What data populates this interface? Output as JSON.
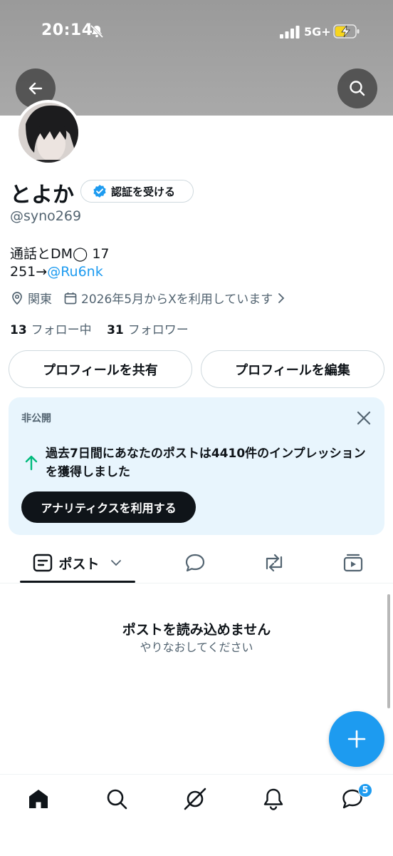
{
  "status_bar": {
    "time": "20:14",
    "network": "5G+"
  },
  "profile": {
    "name": "とよか",
    "verify_label": "認証を受ける",
    "handle": "@syno269",
    "bio_line1": "通話とDM◯ 17",
    "bio_line2_prefix": "251→",
    "bio_link": "@Ru6nk",
    "location": "関東",
    "joined": "2026年5月からXを利用しています",
    "following_count": "13",
    "following_label": "フォロー中",
    "followers_count": "31",
    "followers_label": "フォロワー"
  },
  "actions": {
    "share_label": "プロフィールを共有",
    "edit_label": "プロフィールを編集"
  },
  "analytics_card": {
    "label": "非公開",
    "message": "過去7日間にあなたのポストは4410件のインプレッションを獲得しました",
    "button_label": "アナリティクスを利用する"
  },
  "tabs": {
    "posts_label": "ポスト"
  },
  "empty_state": {
    "title": "ポストを読み込めません",
    "subtitle": "やりなおしてください"
  },
  "bottom_nav": {
    "messages_badge": "5"
  },
  "colors": {
    "accent": "#1d9bf0",
    "text": "#0f1419",
    "secondary": "#536471",
    "card_bg": "#e8f5fd",
    "trend_up": "#00ba7c"
  },
  "icons": [
    "back-arrow-icon",
    "search-icon",
    "verified-badge-icon",
    "location-pin-icon",
    "calendar-icon",
    "chevron-right-icon",
    "close-icon",
    "arrow-up-icon",
    "posts-icon",
    "chevron-down-icon",
    "reply-icon",
    "repost-icon",
    "media-icon",
    "plus-icon",
    "home-icon",
    "grok-icon",
    "bell-icon",
    "messages-icon"
  ]
}
